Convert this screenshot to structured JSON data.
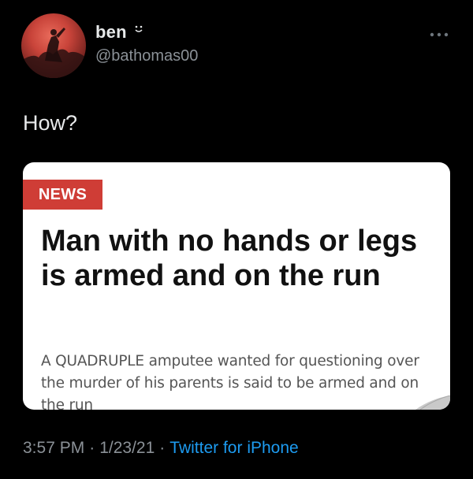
{
  "user": {
    "display_name": "ben",
    "handle": "@bathomas00"
  },
  "tweet": {
    "text": "How?"
  },
  "card": {
    "badge": "NEWS",
    "headline": "Man with no hands or legs is armed and on the run",
    "summary": "A QUADRUPLE amputee wanted for questioning over the murder of his parents is said to be armed and on the run"
  },
  "meta": {
    "time": "3:57 PM",
    "separator": "·",
    "date": "1/23/21",
    "source": "Twitter for iPhone"
  },
  "colors": {
    "background": "#000000",
    "badge": "#cf3d36",
    "link": "#1d9bf0",
    "secondary_text": "#8b9197"
  },
  "icons": {
    "avatar": "avatar-image",
    "name_emoji": "smile-icon",
    "more": "more-options-icon"
  }
}
